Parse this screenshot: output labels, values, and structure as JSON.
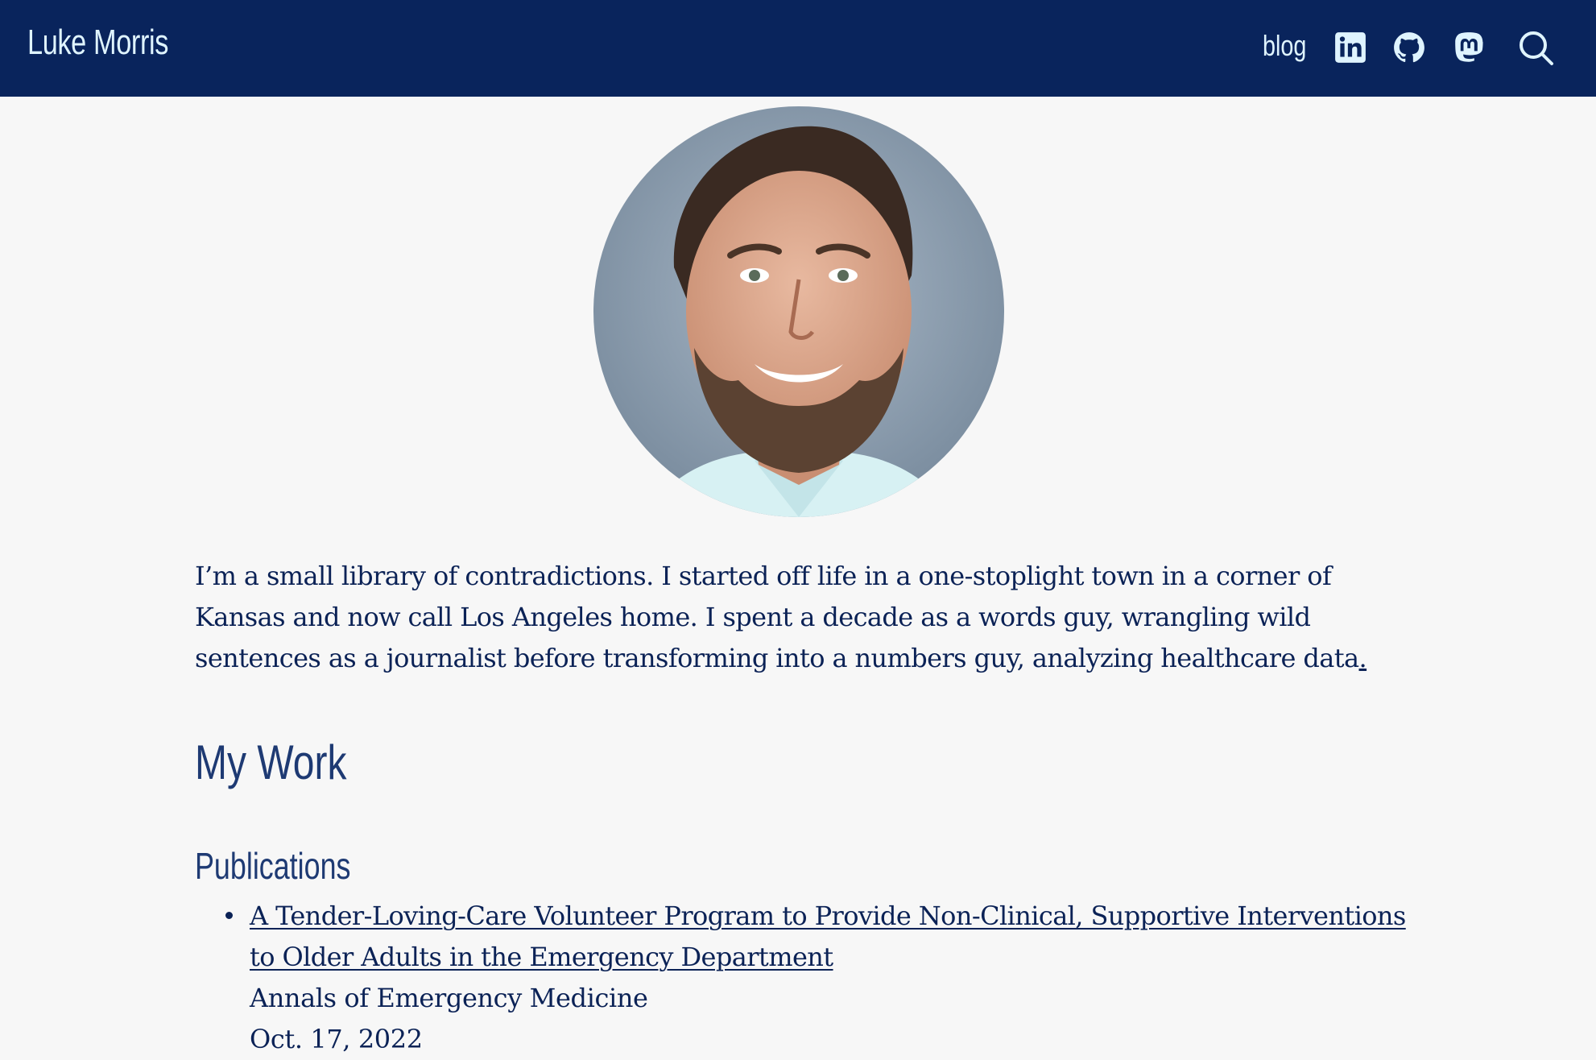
{
  "header": {
    "site_title": "Luke Morris",
    "nav": {
      "blog_label": "blog",
      "icons": [
        "linkedin-icon",
        "github-icon",
        "mastodon-icon",
        "search-icon"
      ]
    }
  },
  "colors": {
    "navbar_bg": "#09245c",
    "nav_text": "#dff4ff",
    "page_bg": "#f7f7f7",
    "text": "#0b2256",
    "heading": "#1e3a73"
  },
  "profile": {
    "photo": "portrait-photo"
  },
  "intro": {
    "text": "I’m a small library of contradictions. I started off life in a one-stoplight town in a corner of Kansas and now call Los Angeles home. I spent a decade as a words guy, wrangling wild sentences as a journalist before transforming into a numbers guy, analyzing healthcare data",
    "link_text": "."
  },
  "sections": {
    "my_work_title": "My Work",
    "publications_title": "Publications"
  },
  "publications": [
    {
      "title": "A Tender-Loving-Care Volunteer Program to Provide Non-Clinical, Supportive Interventions to Older Adults in the Emergency Department",
      "journal": "Annals of Emergency Medicine",
      "date": "Oct. 17, 2022"
    }
  ]
}
